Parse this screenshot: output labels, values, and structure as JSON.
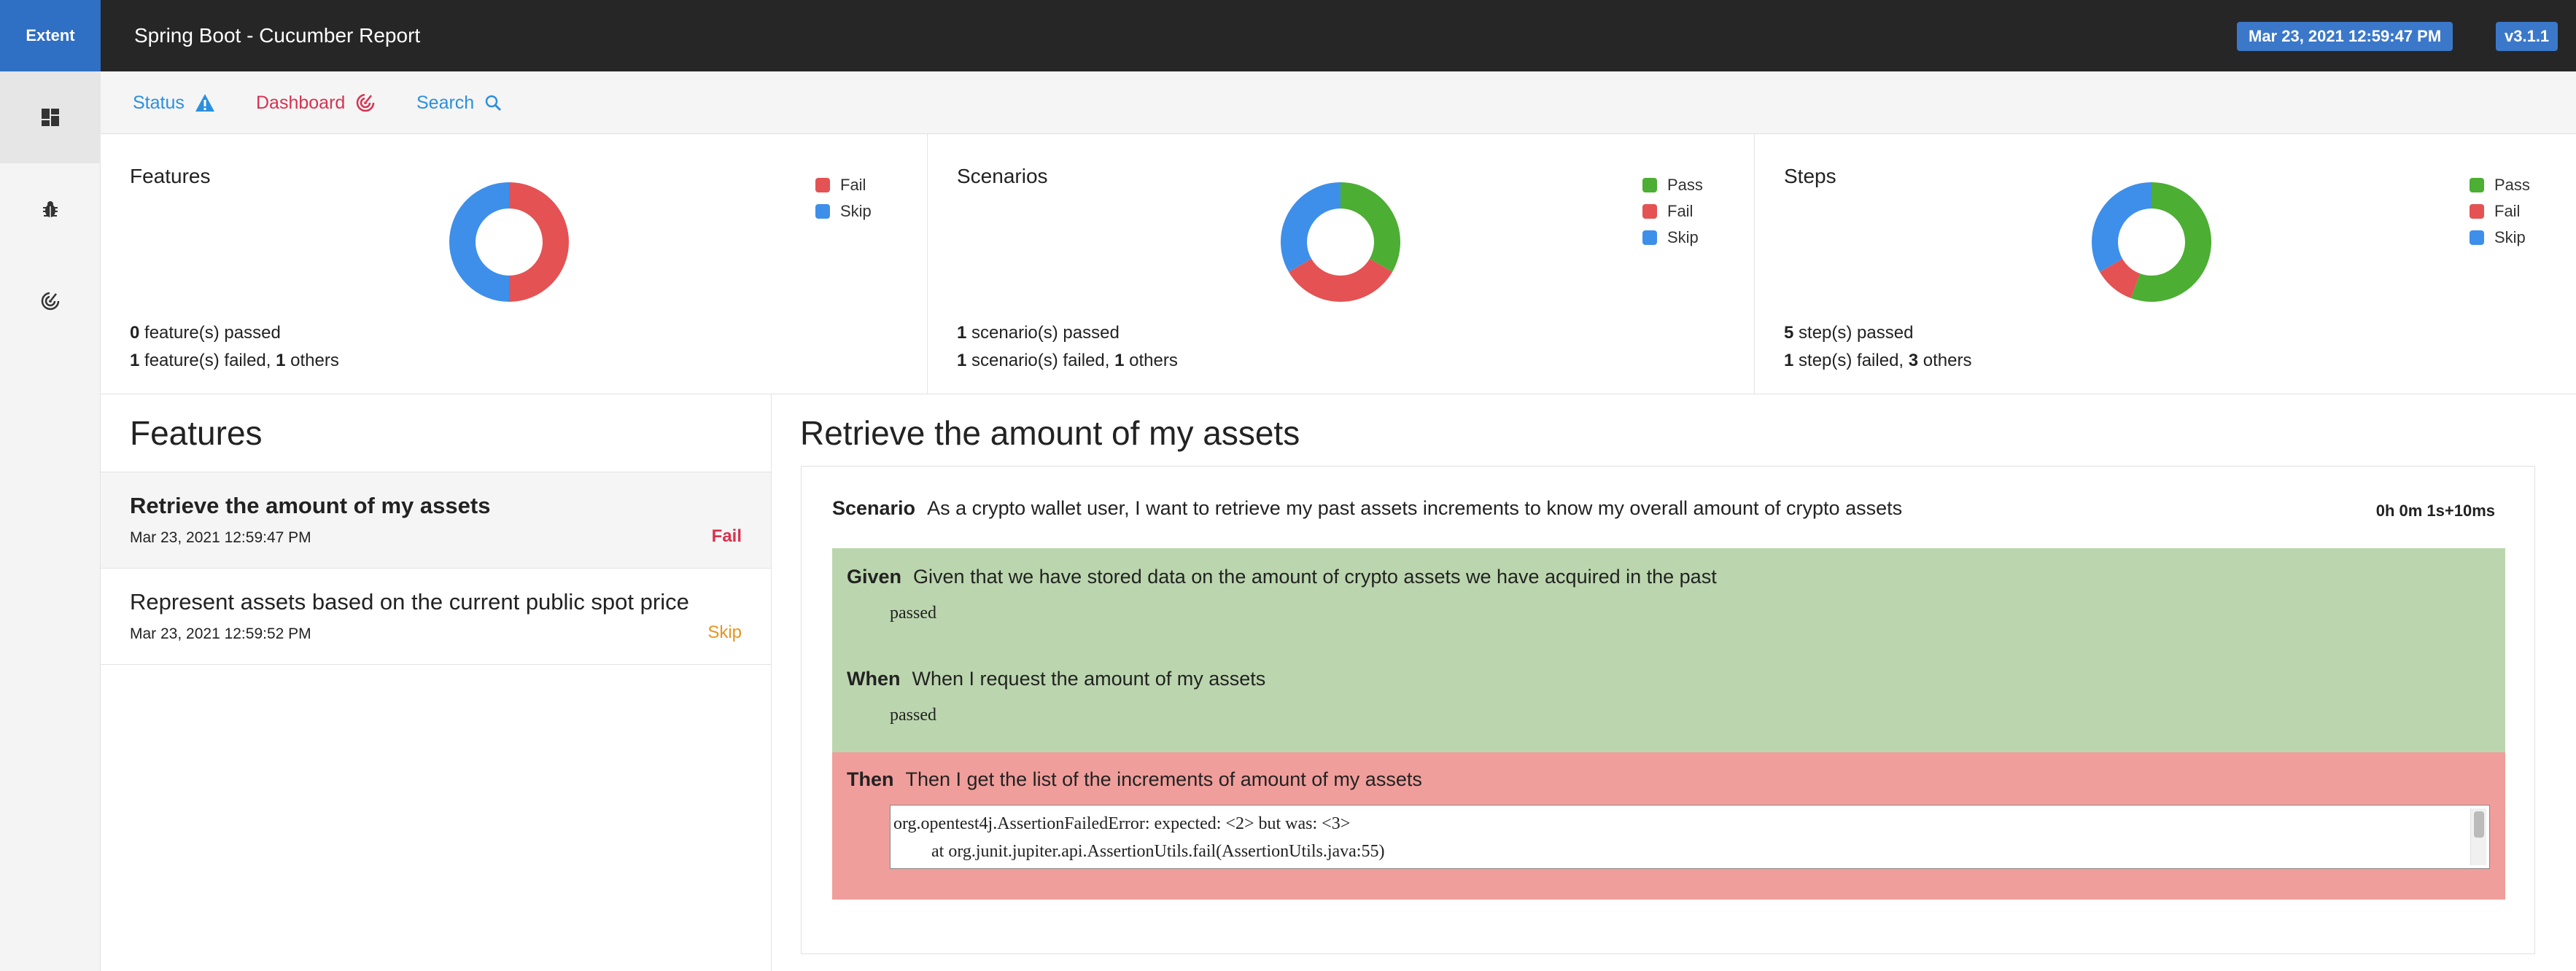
{
  "brand": "Extent",
  "app_title": "Spring Boot - Cucumber Report",
  "report_date": "Mar 23, 2021 12:59:47 PM",
  "version": "v3.1.1",
  "sidebar": {
    "items": [
      {
        "icon": "dashboard-icon"
      },
      {
        "icon": "bug-icon"
      },
      {
        "icon": "target-icon"
      }
    ]
  },
  "nav": {
    "status": "Status",
    "dashboard": "Dashboard",
    "search": "Search"
  },
  "colors": {
    "pass": "#4cae33",
    "fail": "#e45253",
    "skip": "#3e8fea",
    "fail_text": "#d9314f",
    "skip_text": "#e69420",
    "step_pass_bg": "#bbd6ae",
    "step_fail_bg": "#f09e9b"
  },
  "panels": [
    {
      "title": "Features",
      "legend": [
        "Fail",
        "Skip"
      ],
      "summary_line1": {
        "count": "0",
        "text": " feature(s) passed"
      },
      "summary_line2": {
        "count": "1",
        "text": " feature(s) failed, ",
        "others": "1",
        "others_text": " others"
      }
    },
    {
      "title": "Scenarios",
      "legend": [
        "Pass",
        "Fail",
        "Skip"
      ],
      "summary_line1": {
        "count": "1",
        "text": " scenario(s) passed"
      },
      "summary_line2": {
        "count": "1",
        "text": " scenario(s) failed, ",
        "others": "1",
        "others_text": " others"
      }
    },
    {
      "title": "Steps",
      "legend": [
        "Pass",
        "Fail",
        "Skip"
      ],
      "summary_line1": {
        "count": "5",
        "text": " step(s) passed"
      },
      "summary_line2": {
        "count": "1",
        "text": " step(s) failed, ",
        "others": "3",
        "others_text": " others"
      }
    }
  ],
  "chart_data": [
    {
      "type": "pie",
      "title": "Features",
      "categories": [
        "Pass",
        "Fail",
        "Skip"
      ],
      "values": [
        0,
        1,
        1
      ]
    },
    {
      "type": "pie",
      "title": "Scenarios",
      "categories": [
        "Pass",
        "Fail",
        "Skip"
      ],
      "values": [
        1,
        1,
        1
      ]
    },
    {
      "type": "pie",
      "title": "Steps",
      "categories": [
        "Pass",
        "Fail",
        "Skip"
      ],
      "values": [
        5,
        1,
        3
      ]
    }
  ],
  "features": {
    "heading": "Features",
    "items": [
      {
        "name": "Retrieve the amount of my assets",
        "date": "Mar 23, 2021 12:59:47 PM",
        "status": "Fail"
      },
      {
        "name": "Represent assets based on the current public spot price",
        "date": "Mar 23, 2021 12:59:52 PM",
        "status": "Skip"
      }
    ]
  },
  "detail": {
    "title": "Retrieve the amount of my assets",
    "scenario_keyword": "Scenario",
    "scenario_text": "As a crypto wallet user, I want to retrieve my past assets increments to know my overall amount of crypto assets",
    "duration": "0h 0m 1s+10ms",
    "steps": [
      {
        "keyword": "Given",
        "text": "Given that we have stored data on the amount of crypto assets we have acquired in the past",
        "result": "passed"
      },
      {
        "keyword": "When",
        "text": "When I request the amount of my assets",
        "result": "passed"
      },
      {
        "keyword": "Then",
        "text": "Then I get the list of the increments of amount of my assets",
        "error_line1": "org.opentest4j.AssertionFailedError: expected: <2> but was: <3>",
        "error_line2": "at org.junit.jupiter.api.AssertionUtils.fail(AssertionUtils.java:55)"
      }
    ]
  }
}
